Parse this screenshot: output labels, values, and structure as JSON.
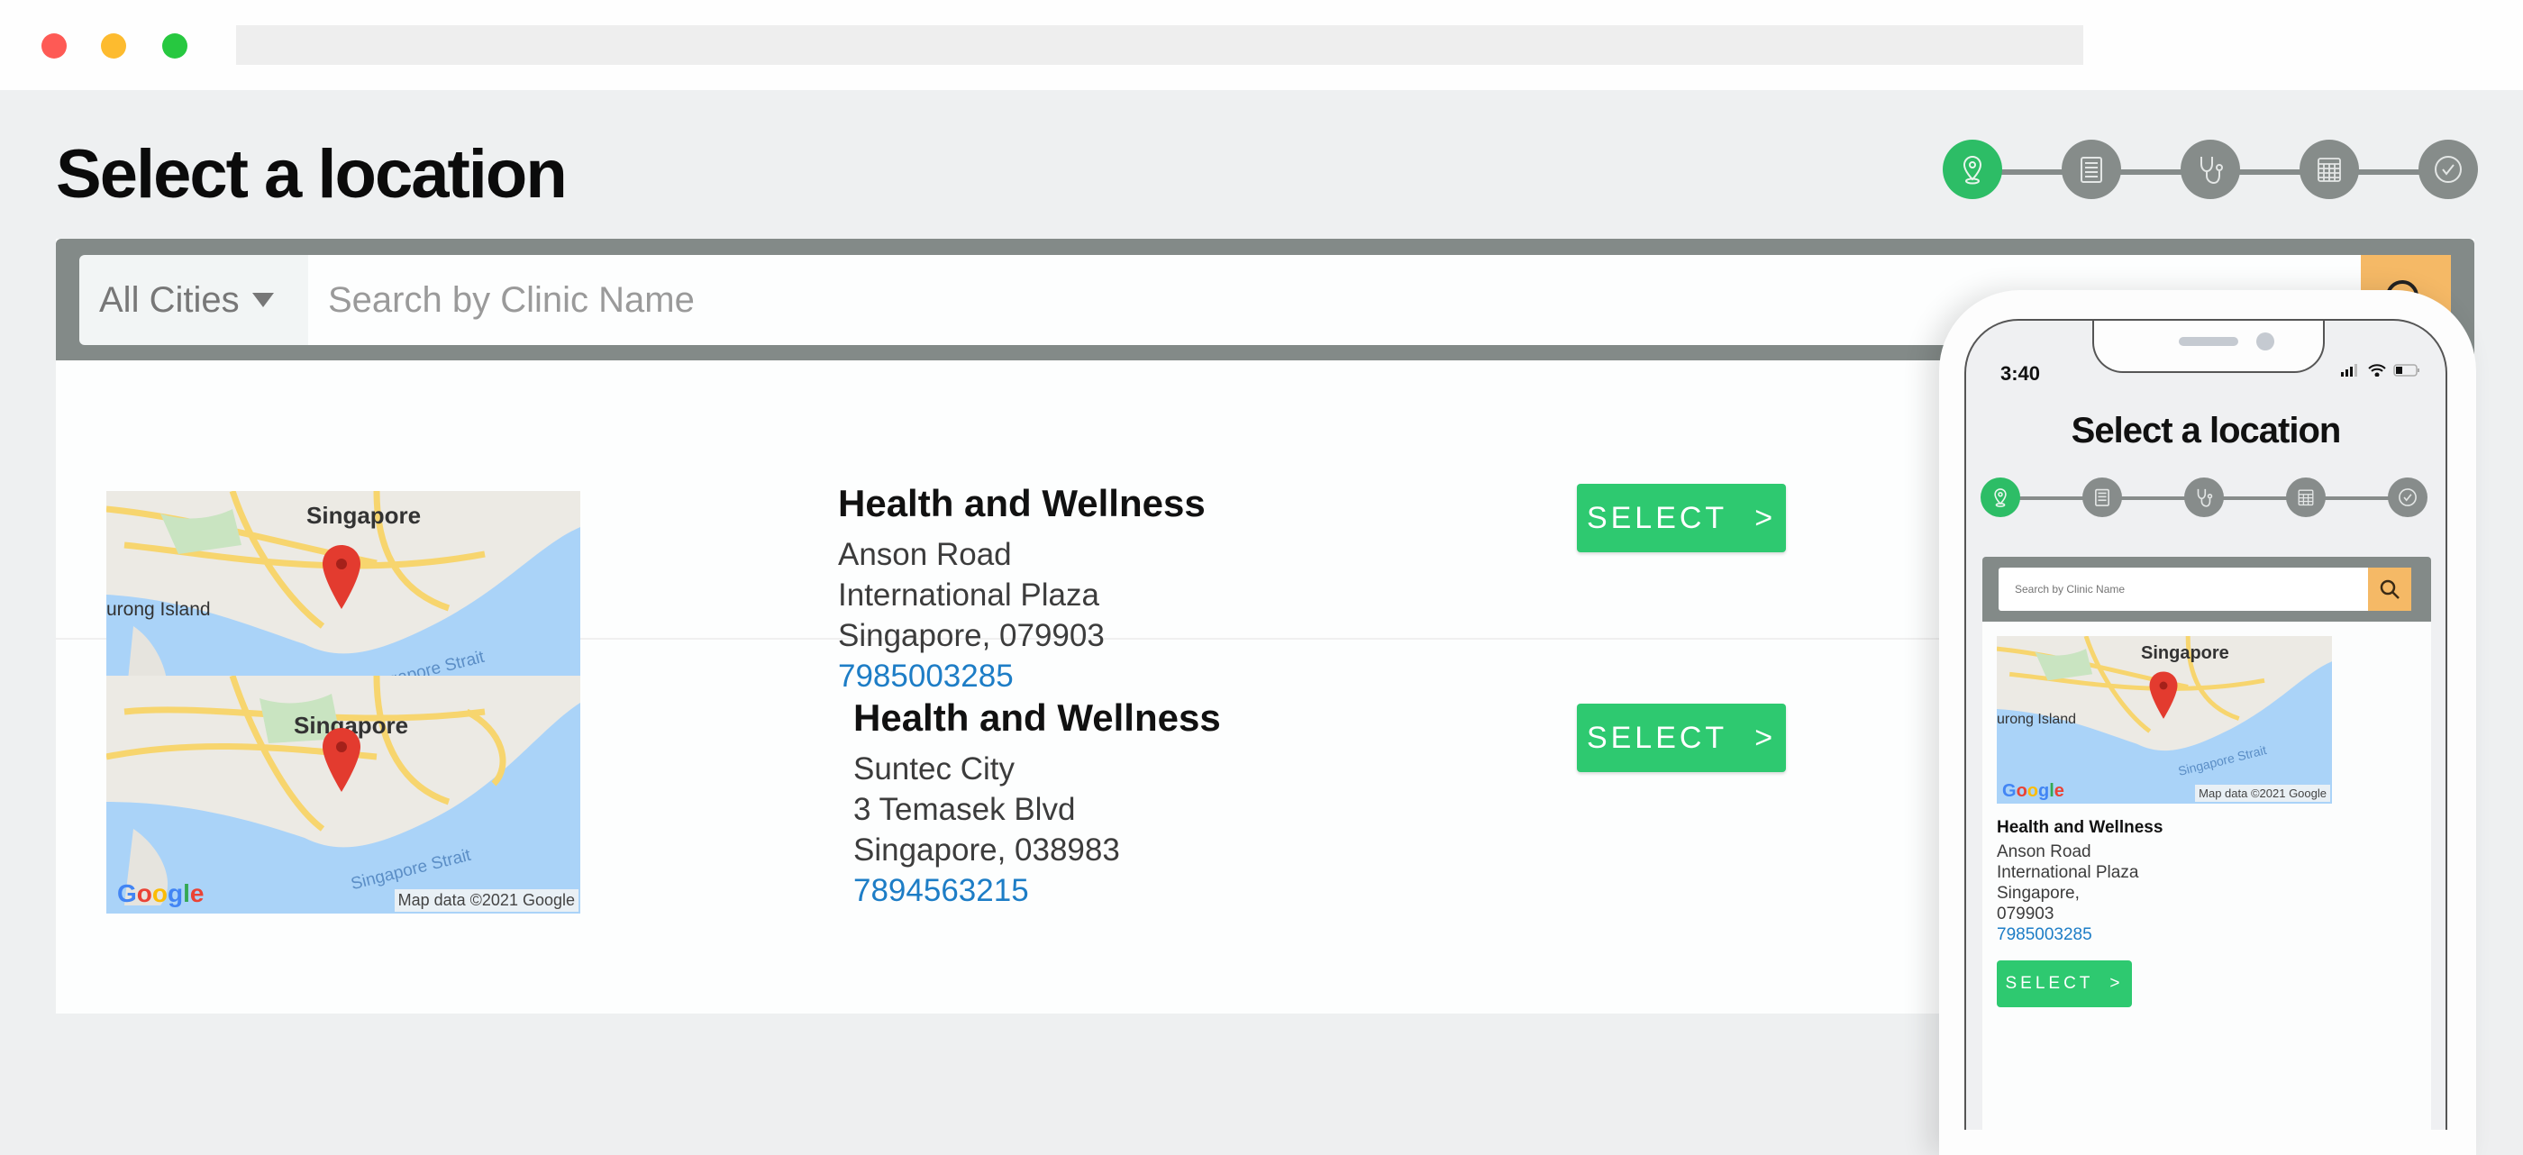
{
  "window": {
    "controls": [
      "close",
      "minimize",
      "maximize"
    ]
  },
  "page": {
    "title": "Select a location"
  },
  "stepper": {
    "steps": [
      {
        "name": "location",
        "icon": "map-pin-icon",
        "active": true
      },
      {
        "name": "details",
        "icon": "document-icon",
        "active": false
      },
      {
        "name": "doctor",
        "icon": "stethoscope-icon",
        "active": false
      },
      {
        "name": "schedule",
        "icon": "calendar-icon",
        "active": false
      },
      {
        "name": "confirm",
        "icon": "check-circle-icon",
        "active": false
      }
    ]
  },
  "search": {
    "city_filter": "All Cities",
    "placeholder": "Search by Clinic Name",
    "button_icon": "search-icon"
  },
  "clinics": [
    {
      "name": "Health and Wellness",
      "address_lines": [
        "Anson Road",
        "International Plaza",
        "Singapore, 079903"
      ],
      "phone": "7985003285",
      "select_label": "SELECT",
      "select_arrow": ">",
      "map": {
        "city_label": "Singapore",
        "island_label": "urong Island",
        "strait_label": "Singapore Strait",
        "brand": "Google",
        "credit": "Map data ©2021 Google"
      }
    },
    {
      "name": "Health and Wellness",
      "address_lines": [
        "Suntec City",
        "3 Temasek Blvd",
        "Singapore, 038983"
      ],
      "phone": "7894563215",
      "select_label": "SELECT",
      "select_arrow": ">",
      "map": {
        "city_label": "Singapore",
        "island_label": "",
        "strait_label": "Singapore Strait",
        "brand": "Google",
        "credit": "Map data ©2021 Google"
      }
    }
  ],
  "phone_mockup": {
    "time": "3:40",
    "title": "Select a location",
    "search_placeholder": "Search by Clinic Name",
    "clinic": {
      "name": "Health and Wellness",
      "address_lines": [
        "Anson Road",
        "International Plaza",
        "Singapore,",
        "079903"
      ],
      "phone": "7985003285",
      "select_label": "SELECT",
      "select_arrow": ">",
      "map": {
        "city_label": "Singapore",
        "island_label": "urong Island",
        "strait_label": "Singapore Strait",
        "brand": "Google",
        "credit": "Map data ©2021 Google"
      }
    }
  },
  "colors": {
    "accent_green": "#2ec970",
    "step_active": "#2dbd66",
    "step_inactive": "#868c8a",
    "search_button": "#f5b966",
    "phone_link": "#1d7dc6",
    "search_bar_bg": "#838a88"
  }
}
